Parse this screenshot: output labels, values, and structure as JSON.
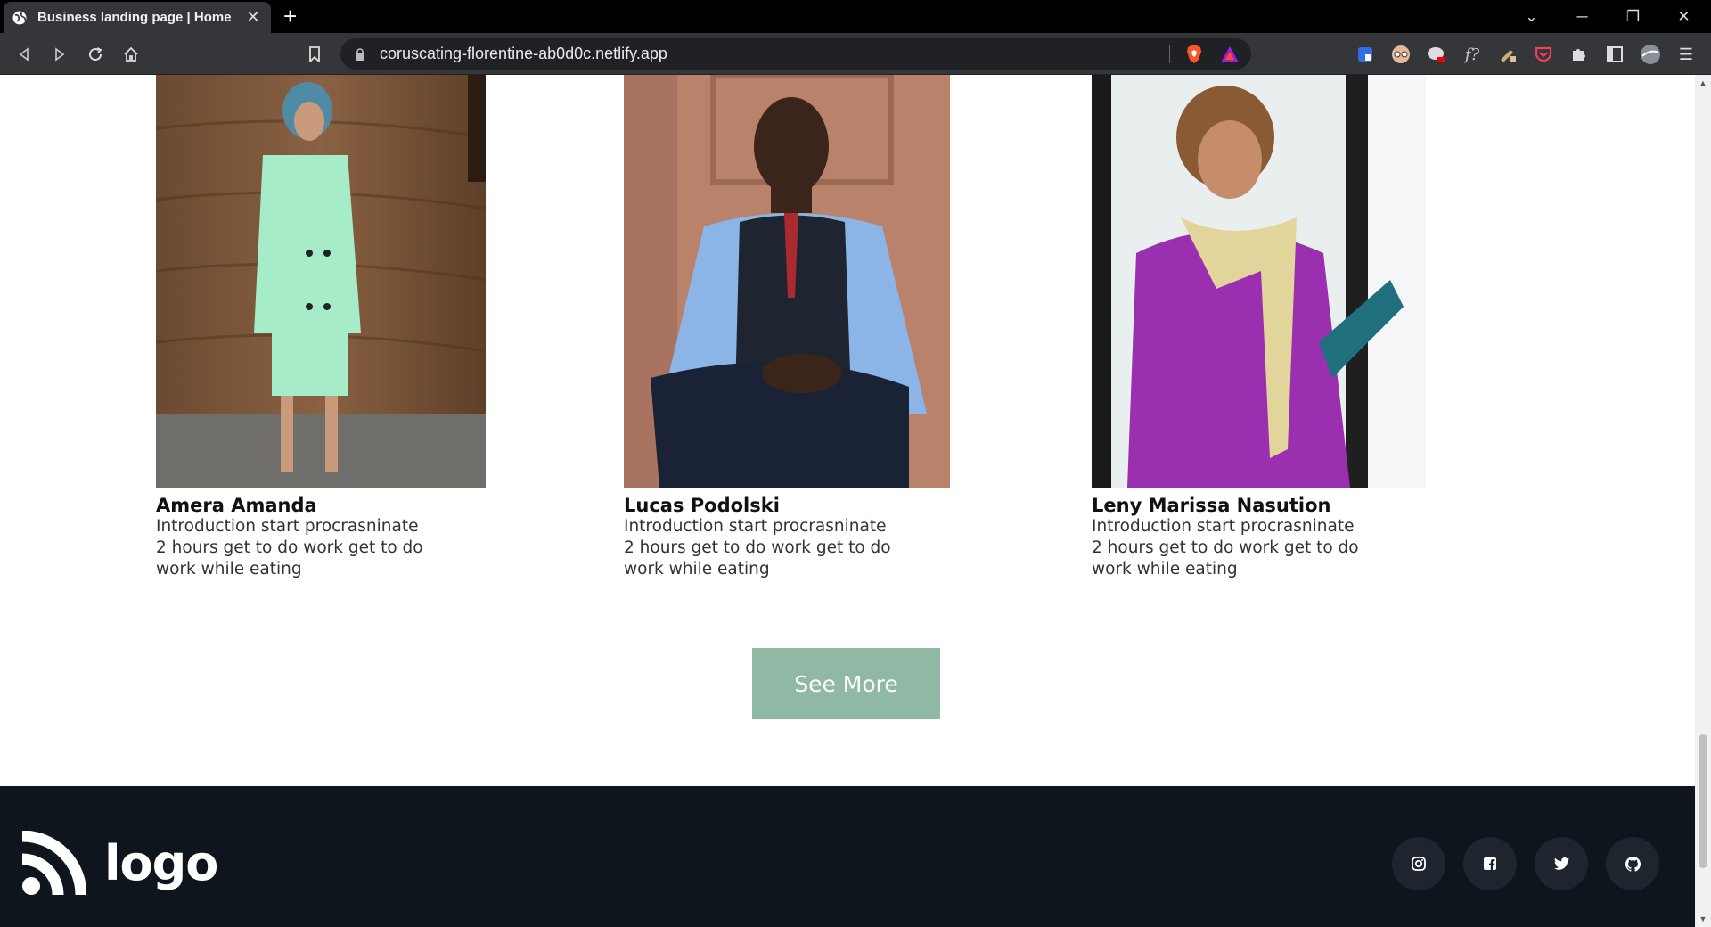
{
  "browser": {
    "tab_title": "Business landing page | Home",
    "url": "coruscating-florentine-ab0d0c.netlify.app"
  },
  "team": [
    {
      "name": "Amera Amanda",
      "description": "Introduction start procrasninate 2 hours get to do work get to do work while eating"
    },
    {
      "name": "Lucas Podolski",
      "description": "Introduction start procrasninate 2 hours get to do work get to do work while eating"
    },
    {
      "name": "Leny Marissa Nasution",
      "description": "Introduction start procrasninate 2 hours get to do work get to do work while eating"
    }
  ],
  "see_more_label": "See More",
  "footer": {
    "logo_text": "logo",
    "social": [
      "instagram-icon",
      "facebook-icon",
      "twitter-icon",
      "github-icon"
    ]
  },
  "colors": {
    "button": "#8fb8a5",
    "footer_bg": "#0f151d",
    "social_bg": "#1f252e"
  }
}
